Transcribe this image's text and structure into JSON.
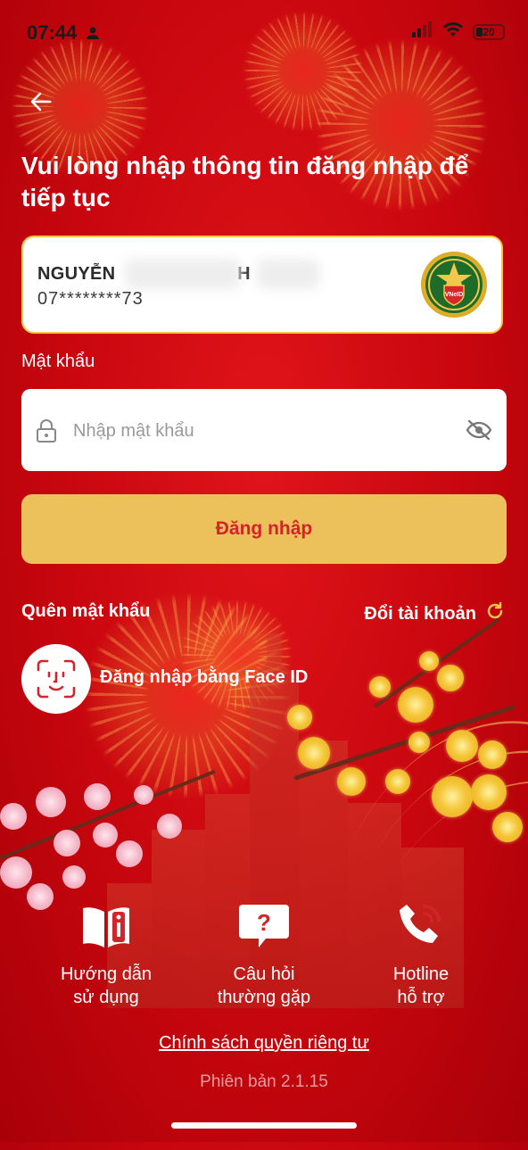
{
  "status": {
    "time": "07:44",
    "battery": "20"
  },
  "header": {
    "title": "Vui lòng nhập thông tin đăng nhập để tiếp tục"
  },
  "account": {
    "name_prefix": "NGUYỄN",
    "name_suffix": "H",
    "phone": "07********73",
    "badge_text": "VNeID"
  },
  "password": {
    "label": "Mật khẩu",
    "placeholder": "Nhập mật khẩu"
  },
  "login_button": "Đăng nhập",
  "links": {
    "forgot_password": "Quên mật khẩu",
    "switch_account": "Đổi tài khoản"
  },
  "face_id": {
    "label": "Đăng nhập bằng Face ID"
  },
  "bottom_nav": [
    {
      "line1": "Hướng dẫn",
      "line2": "sử dụng",
      "icon": "book-info-icon"
    },
    {
      "line1": "Câu hỏi",
      "line2": "thường gặp",
      "icon": "question-bubble-icon"
    },
    {
      "line1": "Hotline",
      "line2": "hỗ trợ",
      "icon": "phone-icon"
    }
  ],
  "privacy_link": "Chính sách quyền riêng tư",
  "version": "Phiên bản 2.1.15",
  "colors": {
    "background": "#c8060e",
    "login_button_bg": "#ecc05a",
    "login_button_text": "#d2242a",
    "card_border": "#f2c84b"
  }
}
